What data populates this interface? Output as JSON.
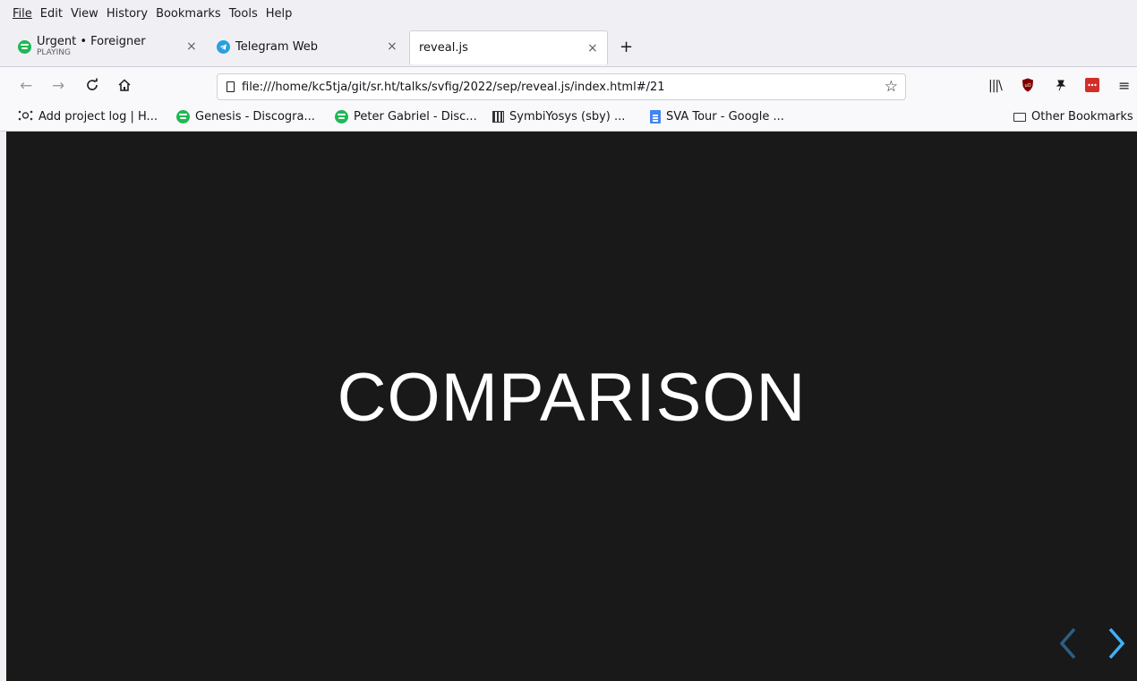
{
  "menu": [
    "File",
    "Edit",
    "View",
    "History",
    "Bookmarks",
    "Tools",
    "Help"
  ],
  "tabs": [
    {
      "title": "Urgent • Foreigner",
      "subtitle": "PLAYING",
      "icon": "spotify-icon",
      "active": false
    },
    {
      "title": "Telegram Web",
      "icon": "telegram-icon",
      "active": false
    },
    {
      "title": "reveal.js",
      "active": true
    }
  ],
  "tab_close_glyph": "×",
  "new_tab_glyph": "+",
  "nav": {
    "url": "file:///home/kc5tja/git/sr.ht/talks/svfig/2022/sep/reveal.js/index.html#/21"
  },
  "bookmarks": [
    {
      "label": "Add project log | H...",
      "icon": "hackaday-icon"
    },
    {
      "label": "Genesis - Discogra...",
      "icon": "spotify-icon"
    },
    {
      "label": "Peter Gabriel - Disc...",
      "icon": "spotify-icon"
    },
    {
      "label": "SymbiYosys (sby) ...",
      "icon": "symbiyosys-icon"
    },
    {
      "label": "SVA Tour - Google ...",
      "icon": "google-docs-icon"
    }
  ],
  "other_bookmarks": "Other Bookmarks",
  "slide": {
    "title": "COMPARISON"
  },
  "colors": {
    "slide_bg": "#191919",
    "slide_text": "#ffffff",
    "arrow_accent": "#42affa",
    "arrow_dim": "#2a5f86"
  }
}
